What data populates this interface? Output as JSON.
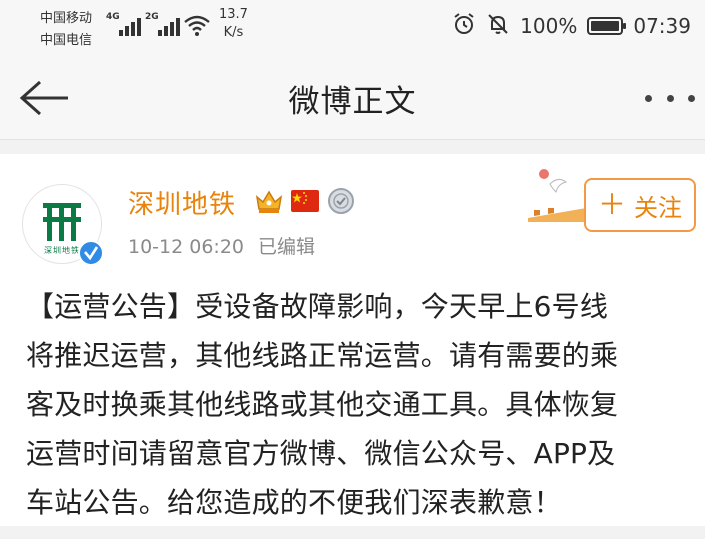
{
  "status_bar": {
    "carrier_1": "中国移动",
    "carrier_2": "中国电信",
    "signal_1_tag": "4G",
    "signal_2_tag": "2G",
    "net_speed_value": "13.7",
    "net_speed_unit": "K/s",
    "battery_percent": "100%",
    "battery_level": 1.0,
    "time": "07:39",
    "icons": [
      "alarm-icon",
      "mute-bell-icon",
      "wifi-icon",
      "battery-icon"
    ]
  },
  "nav": {
    "title": "微博正文",
    "back_icon": "arrow-left-icon",
    "more_icon": "more-dots-icon"
  },
  "post": {
    "author": "深圳地铁",
    "badges": [
      "vip-crown-icon",
      "china-flag-icon",
      "medal-icon"
    ],
    "avatar_logo_text": "深圳地铁",
    "timestamp": "10-12 06:20",
    "edited_label": "已编辑",
    "follow_label": "关注",
    "content_lines": [
      "【运营公告】受设备故障影响，今天早上6号线",
      "将推迟运营，其他线路正常运营。请有需要的乘",
      "客及时换乘其他线路或其他交通工具。具体恢复",
      "运营时间请留意官方微博、微信公众号、APP及",
      "车站公告。给您造成的不便我们深表歉意！"
    ]
  },
  "colors": {
    "accent_orange": "#e8830c",
    "verified_blue": "#2f8be6",
    "metro_green": "#0b7a45"
  }
}
